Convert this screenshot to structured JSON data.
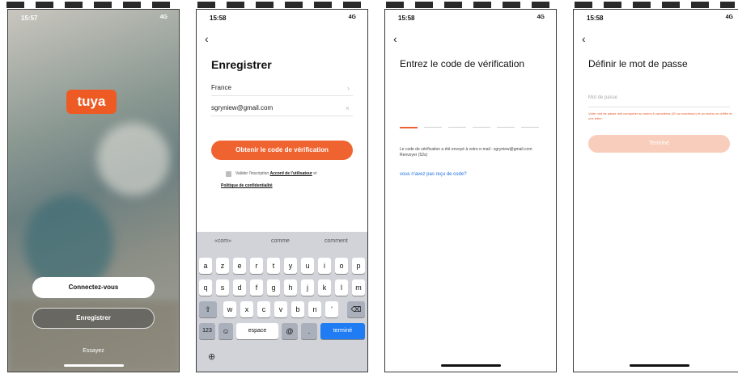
{
  "colors": {
    "accent": "#ef6330",
    "link": "#1c6fdc",
    "error": "#e45a2a"
  },
  "screen1": {
    "time": "15:57",
    "network": "4G",
    "logo_text": "tuya",
    "login_label": "Connectez-vous",
    "register_label": "Enregistrer",
    "try_label": "Essayez"
  },
  "screen2": {
    "time": "15:58",
    "network": "4G",
    "title": "Enregistrer",
    "country": "France",
    "email": "sgryniew@gmail.com",
    "get_code_label": "Obtenir le code de vérification",
    "agree_prefix": "Valider l'inscription",
    "agree_terms": "Accord de l'utilisateur",
    "agree_and": "et",
    "privacy": "Politique de confidentialité",
    "keyboard": {
      "suggestions": [
        "«com»",
        "comme",
        "comment"
      ],
      "row1": [
        "a",
        "z",
        "e",
        "r",
        "t",
        "y",
        "u",
        "i",
        "o",
        "p"
      ],
      "row2": [
        "q",
        "s",
        "d",
        "f",
        "g",
        "h",
        "j",
        "k",
        "l",
        "m"
      ],
      "row3": [
        "w",
        "x",
        "c",
        "v",
        "b",
        "n",
        "'"
      ],
      "numbers": "123",
      "space": "espace",
      "at": "@",
      "dot": ".",
      "done": "terminé"
    }
  },
  "screen3": {
    "time": "15:58",
    "network": "4G",
    "title": "Entrez le code de vérification",
    "info": "Le code de vérification a été envoyé à votre e-mail : sgryniew@gmail.com Renvoyer (52s)",
    "resend_link": "vous n'avez pas reçu de code?"
  },
  "screen4": {
    "time": "15:58",
    "network": "4G",
    "title": "Définir le mot de passe",
    "placeholder": "Mot de passe",
    "error": "Votre mot de passe doit comporter au moins 6 caractères (20 au maximum) et au moins un chiffre et une lettre.",
    "done_label": "Terminé"
  }
}
